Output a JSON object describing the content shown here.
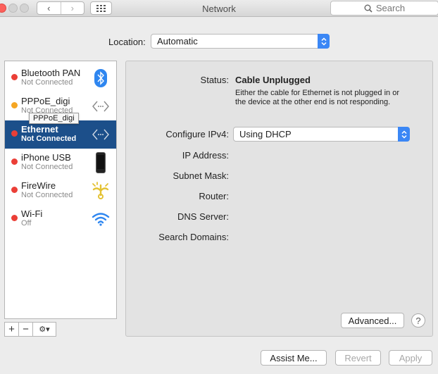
{
  "window": {
    "title": "Network",
    "search_placeholder": "Search"
  },
  "location": {
    "label": "Location:",
    "value": "Automatic"
  },
  "services": [
    {
      "name": "Bluetooth PAN",
      "status": "Not Connected",
      "dot": "red",
      "icon": "bluetooth-icon"
    },
    {
      "name": "PPPoE_digi",
      "status": "Not Connected",
      "dot": "amber",
      "icon": "network-arrows-icon"
    },
    {
      "name": "Ethernet",
      "status": "Not Connected",
      "dot": "red",
      "icon": "network-arrows-icon",
      "selected": true
    },
    {
      "name": "iPhone USB",
      "status": "Not Connected",
      "dot": "red",
      "icon": "iphone-icon"
    },
    {
      "name": "FireWire",
      "status": "Not Connected",
      "dot": "red",
      "icon": "firewire-icon"
    },
    {
      "name": "Wi-Fi",
      "status": "Off",
      "dot": "red",
      "icon": "wifi-icon"
    }
  ],
  "tooltip": "PPPoE_digi",
  "list_toolbar": {
    "add": "+",
    "remove": "−",
    "action": "⚙▾"
  },
  "details": {
    "status_label": "Status:",
    "status_value": "Cable Unplugged",
    "status_description": "Either the cable for Ethernet is not plugged in or the device at the other end is not responding.",
    "configure_label": "Configure IPv4:",
    "configure_value": "Using DHCP",
    "ip_label": "IP Address:",
    "subnet_label": "Subnet Mask:",
    "router_label": "Router:",
    "dns_label": "DNS Server:",
    "search_domains_label": "Search Domains:",
    "advanced_button": "Advanced...",
    "help_button": "?"
  },
  "footer": {
    "assist_button": "Assist Me...",
    "revert_button": "Revert",
    "apply_button": "Apply"
  },
  "colors": {
    "selection": "#1c4f8a",
    "status_red": "#eb3f37",
    "status_amber": "#f5a623",
    "accent_blue": "#3b87f5"
  }
}
